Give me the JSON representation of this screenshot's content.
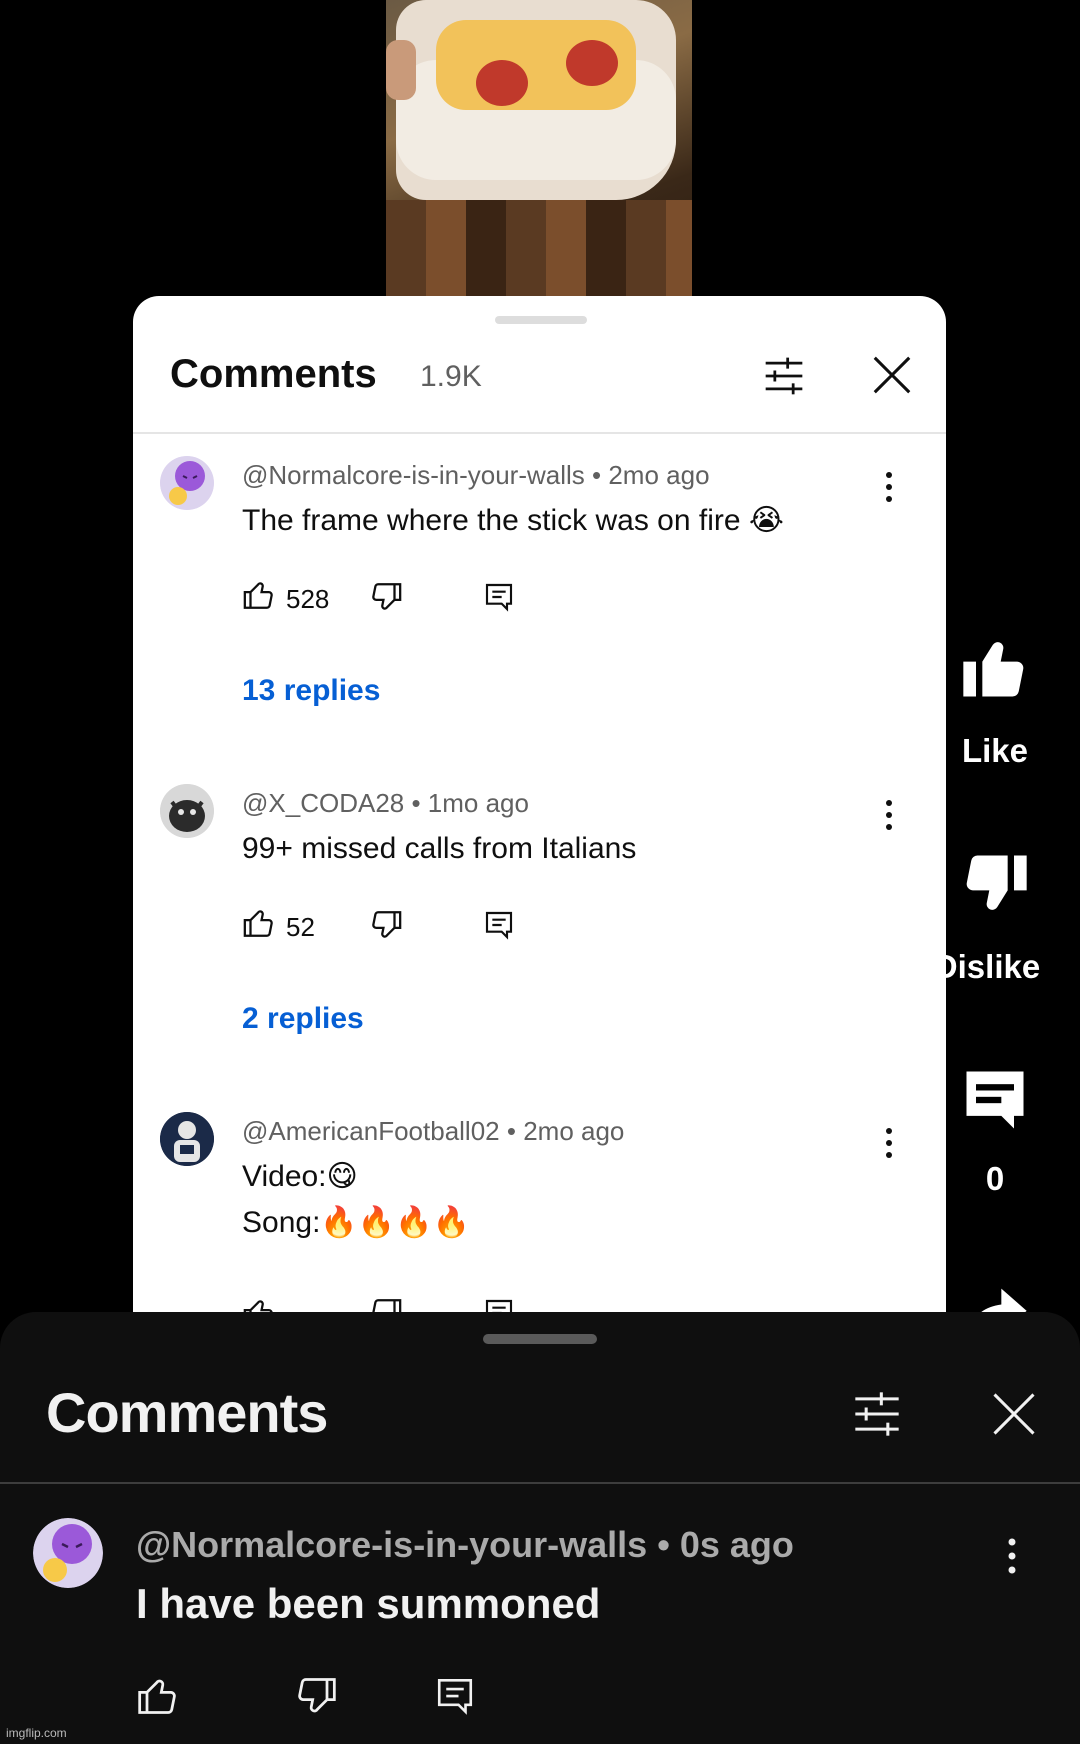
{
  "sheet": {
    "title": "Comments",
    "count": "1.9K"
  },
  "comments": [
    {
      "handle": "@Normalcore-is-in-your-walls",
      "time": "2mo ago",
      "text": "The frame where the stick was on fire 😭",
      "likes": "528",
      "replies": "13 replies"
    },
    {
      "handle": "@X_CODA28",
      "time": "1mo ago",
      "text": "99+ missed calls from Italians",
      "likes": "52",
      "replies": "2 replies"
    },
    {
      "handle": "@AmericanFootball02",
      "time": "2mo ago",
      "text_line1": "Video:😋",
      "text_line2": "Song:🔥🔥🔥🔥"
    }
  ],
  "rail": {
    "like_label": "Like",
    "dislike_label": "Dislike",
    "comment_count": "0"
  },
  "dark_sheet": {
    "title": "Comments",
    "handle": "@Normalcore-is-in-your-walls",
    "time": "0s ago",
    "text": "I have been summoned"
  },
  "watermark": "imgflip.com",
  "colors": {
    "link_blue": "#065fd4",
    "dark_bg": "#0f0f0f",
    "avatar_purple": "#9b59d9"
  }
}
